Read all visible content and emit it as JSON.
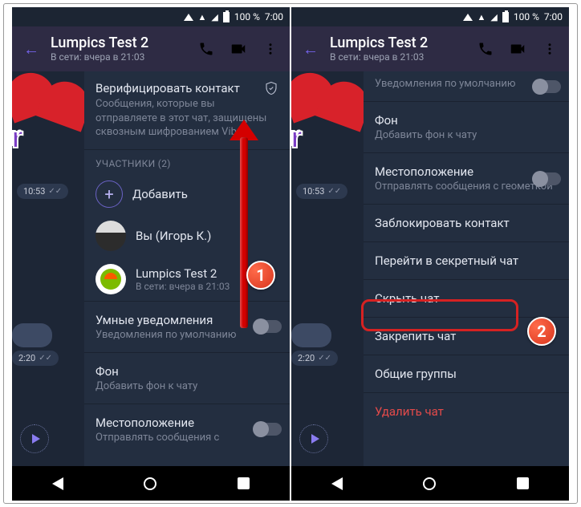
{
  "status": {
    "battery": "100 %",
    "time": "7:00"
  },
  "header": {
    "title": "Lumpics Test 2",
    "subtitle": "В сети: вчера в 21:03"
  },
  "left": {
    "verify": {
      "title": "Верифицировать контакт",
      "desc": "Сообщения, которые вы отправляете в этот чат, защищены сквозным шифрованием Viber."
    },
    "participants_caption": "УЧАСТНИКИ (2)",
    "add": "Добавить",
    "you": "Вы (Игорь К.)",
    "contact": {
      "name": "Lumpics Test 2",
      "status": "В сети: вчера в 21:03"
    },
    "smart": {
      "title": "Умные уведомления",
      "sub": "Уведомления по умолчанию"
    },
    "bg": {
      "title": "Фон",
      "sub": "Добавить фон к чату"
    },
    "loc": {
      "title": "Местоположение",
      "sub": "Отправлять сообщения с"
    },
    "time1": "10:53",
    "time2": "2:20"
  },
  "right": {
    "notif": "Уведомления по умолчанию",
    "bg": {
      "title": "Фон",
      "sub": "Добавить фон к чату"
    },
    "loc": {
      "title": "Местоположение",
      "sub": "Отправлять сообщения с геометкой"
    },
    "block": "Заблокировать контакт",
    "secret": "Перейти в секретный чат",
    "hide": "Скрыть чат",
    "pin": "Закрепить чат",
    "groups": "Общие группы",
    "delete": "Удалить чат",
    "time1": "10:53",
    "time2": "2:20"
  },
  "badges": {
    "one": "1",
    "two": "2"
  }
}
